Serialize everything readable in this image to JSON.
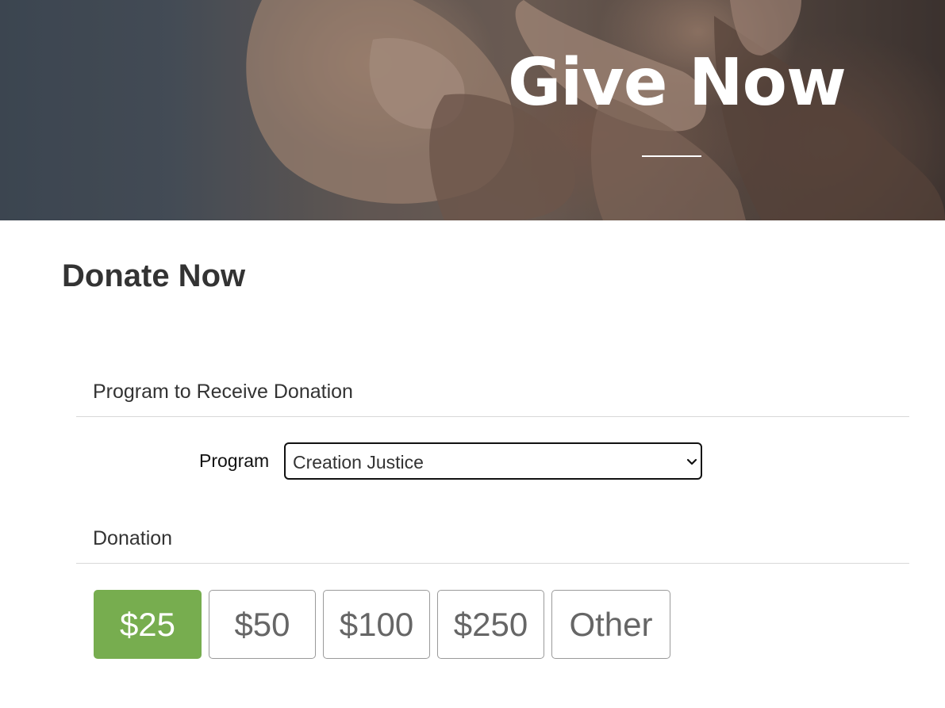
{
  "hero": {
    "title": "Give Now",
    "image": "holding-hands-photo"
  },
  "page": {
    "title": "Donate Now"
  },
  "program_section": {
    "heading": "Program to Receive Donation",
    "field_label": "Program",
    "selected_value": "Creation Justice",
    "chevron_icon": "chevron-down-icon"
  },
  "donation_section": {
    "heading": "Donation",
    "amounts": [
      "$25",
      "$50",
      "$100",
      "$250",
      "Other"
    ],
    "selected": "$25"
  },
  "colors": {
    "accent": "#77ad4f",
    "text_dark": "#333333",
    "button_border": "#9a9a9a"
  }
}
